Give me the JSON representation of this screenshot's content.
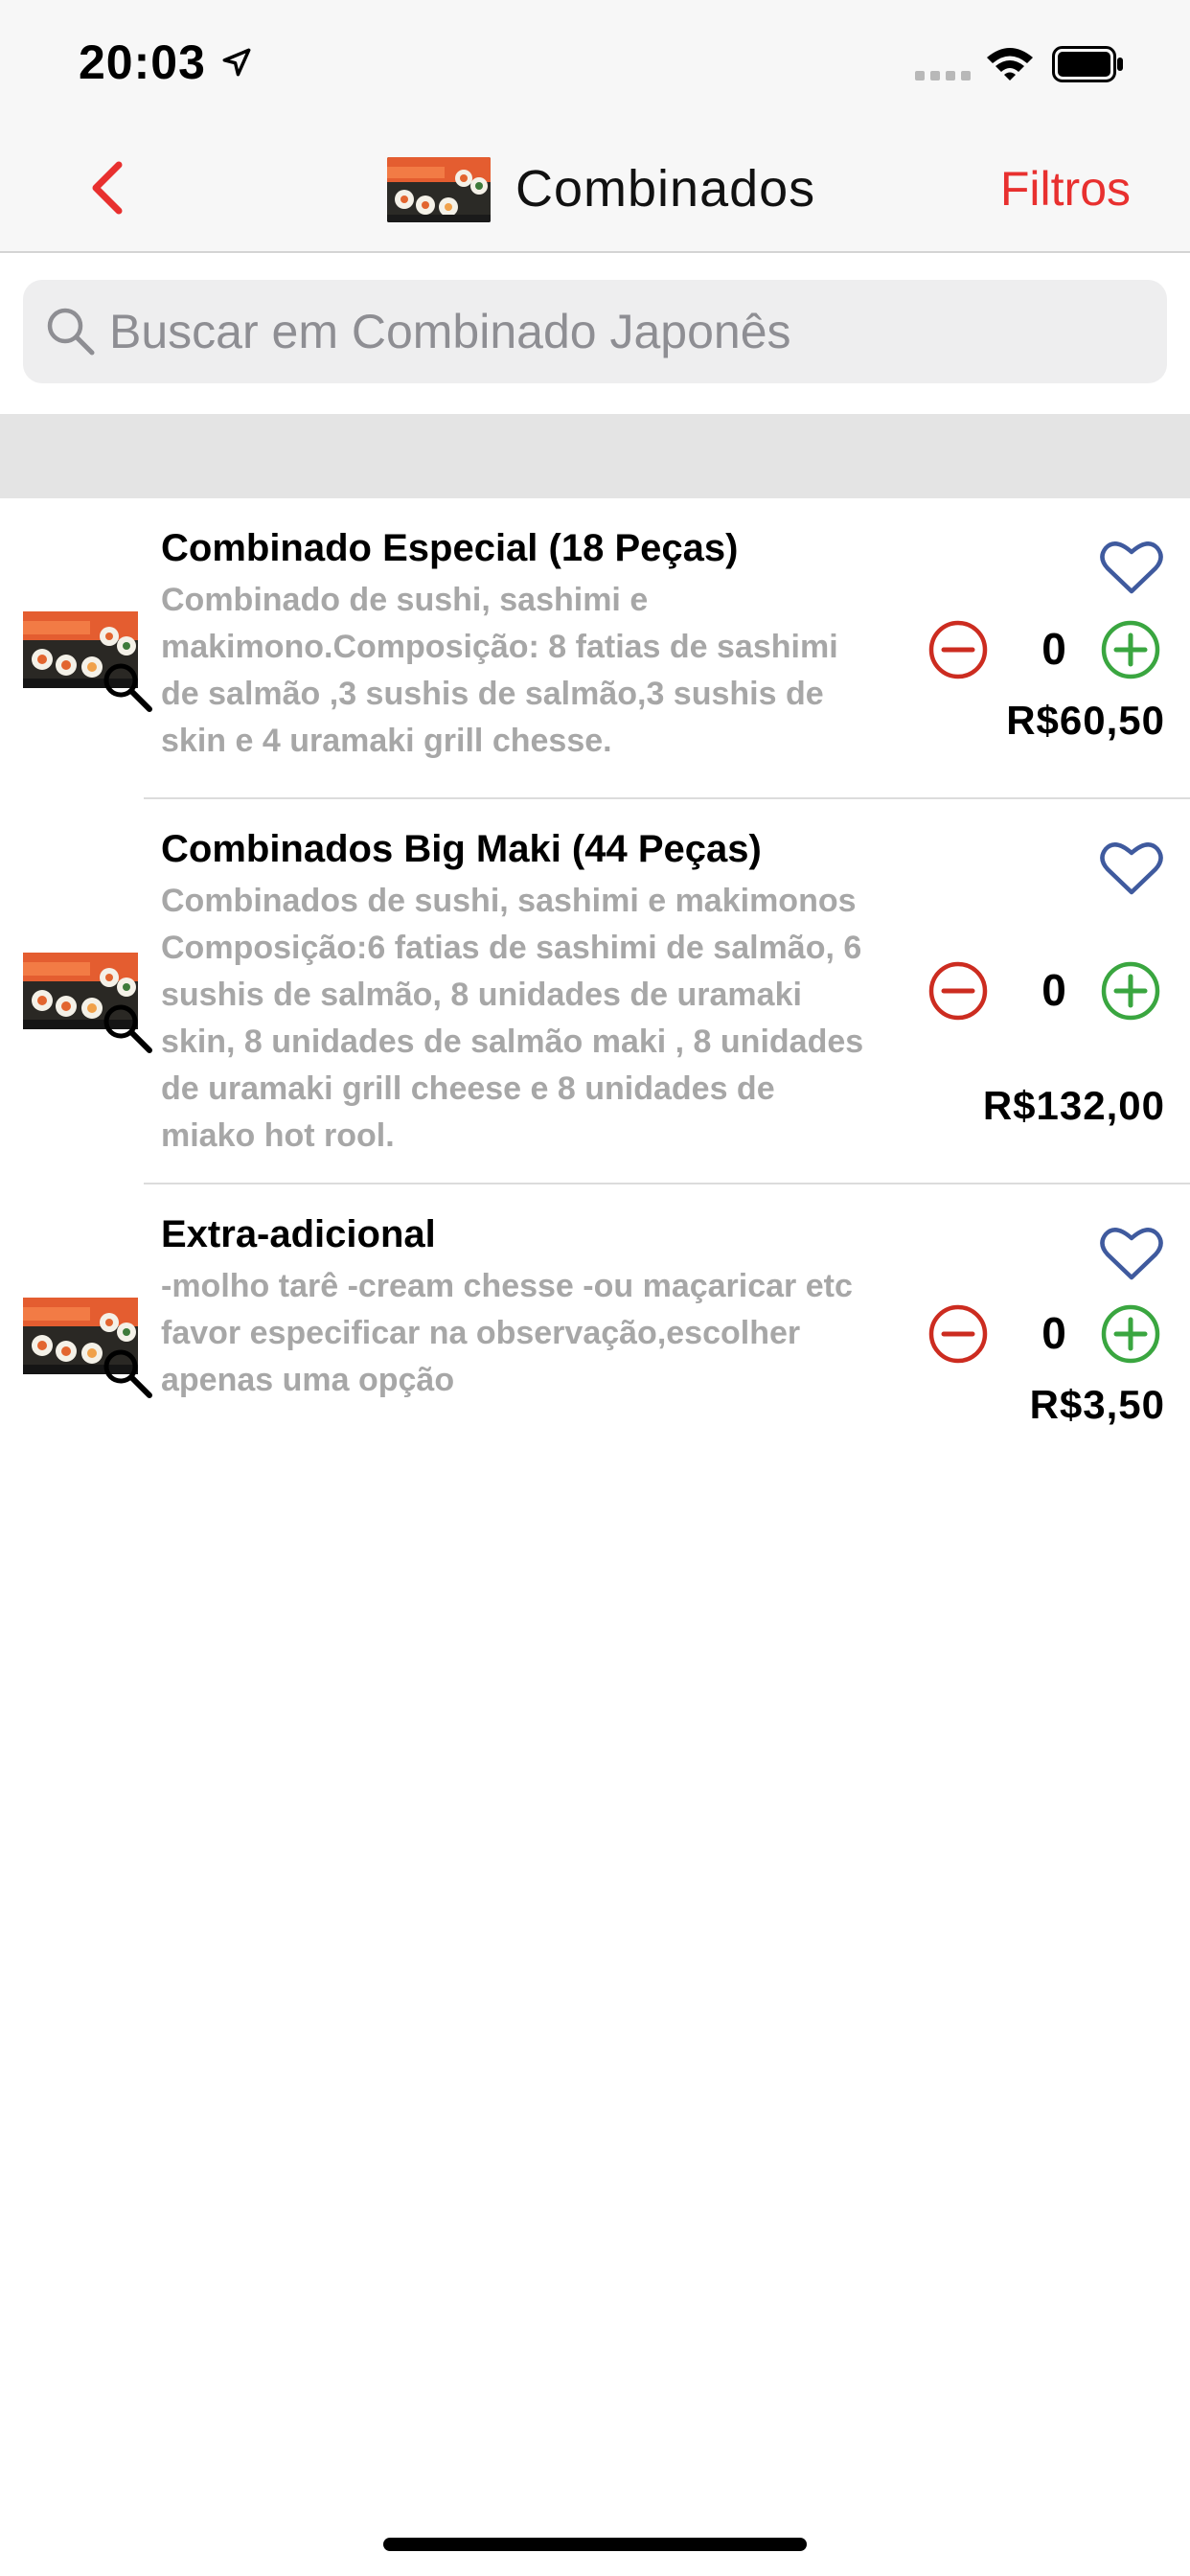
{
  "status_bar": {
    "time": "20:03"
  },
  "nav": {
    "back_icon": "chevron-left-icon",
    "title": "Combinados",
    "filters_label": "Filtros"
  },
  "colors": {
    "accent": "#e8302f",
    "heart": "#3f5a9e",
    "minus": "#cc2c20",
    "plus": "#3aa640",
    "description": "#a7a7a7"
  },
  "search": {
    "placeholder": "Buscar em Combinado Japonês"
  },
  "items": [
    {
      "name": "Combinado Especial (18 Peças)",
      "description": "Combinado de sushi, sashimi e makimono.Composição: 8 fatias de sashimi de salmão ,3 sushis de salmão,3 sushis de skin e 4 uramaki grill chesse.",
      "quantity": "0",
      "price": "R$60,50"
    },
    {
      "name": "Combinados Big Maki (44 Peças)",
      "description": "Combinados de sushi, sashimi e makimonos Composição:6 fatias de sashimi de salmão, 6 sushis de salmão, 8 unidades de uramaki skin, 8 unidades de salmão maki , 8 unidades de uramaki grill cheese e 8 unidades de miako hot rool.",
      "quantity": "0",
      "price": "R$132,00"
    },
    {
      "name": "Extra-adicional",
      "description": "-molho tarê -cream chesse -ou maçaricar etc favor especificar na observação,escolher apenas uma opção",
      "quantity": "0",
      "price": "R$3,50"
    }
  ]
}
